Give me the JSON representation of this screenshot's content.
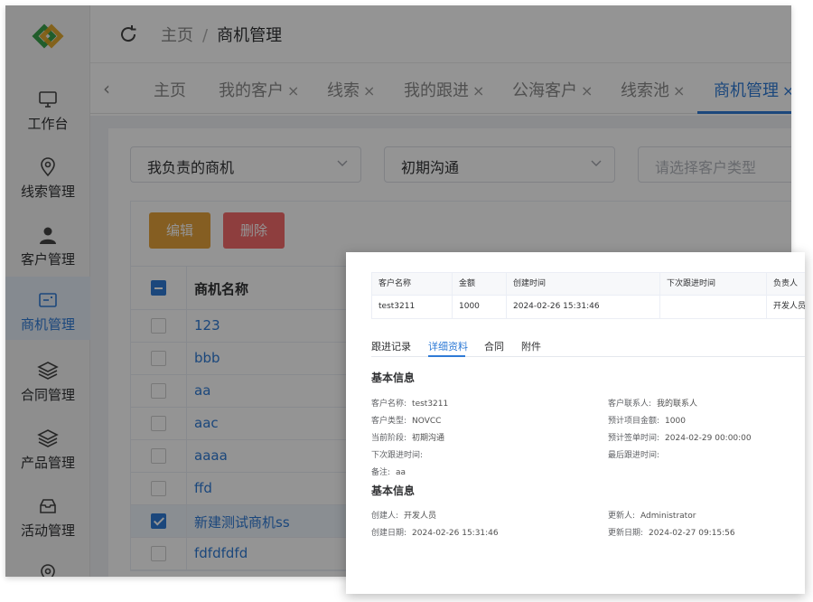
{
  "colors": {
    "primary": "#2f7bd6",
    "warning": "#e6a23c",
    "danger": "#f56c6c"
  },
  "sidebar": {
    "logo_icon": "logo-icon",
    "items": [
      {
        "label": "工作台",
        "icon": "monitor-icon"
      },
      {
        "label": "线索管理",
        "icon": "location-pin-icon"
      },
      {
        "label": "客户管理",
        "icon": "user-icon"
      },
      {
        "label": "商机管理",
        "icon": "opportunity-icon",
        "active": true
      },
      {
        "label": "合同管理",
        "icon": "layers-icon"
      },
      {
        "label": "产品管理",
        "icon": "layers-icon"
      },
      {
        "label": "活动管理",
        "icon": "inbox-icon"
      }
    ]
  },
  "header": {
    "breadcrumb_home": "主页",
    "breadcrumb_sep": "/",
    "breadcrumb_current": "商机管理"
  },
  "tabs": [
    {
      "label": "主页"
    },
    {
      "label": "我的客户",
      "close": "×"
    },
    {
      "label": "线索",
      "close": "×"
    },
    {
      "label": "我的跟进",
      "close": "×"
    },
    {
      "label": "公海客户",
      "close": "×"
    },
    {
      "label": "线索池",
      "close": "×"
    },
    {
      "label": "商机管理",
      "close": "×",
      "active": true
    }
  ],
  "filters": {
    "owner_value": "我负责的商机",
    "stage_value": "初期沟通",
    "customer_type_placeholder": "请选择客户类型"
  },
  "toolbar": {
    "edit_label": "编辑",
    "delete_label": "删除"
  },
  "list": {
    "header": "商机名称",
    "rows": [
      {
        "name": "123",
        "checked": false
      },
      {
        "name": "bbb",
        "checked": false
      },
      {
        "name": "aa",
        "checked": false
      },
      {
        "name": "aac",
        "checked": false
      },
      {
        "name": "aaaa",
        "checked": false
      },
      {
        "name": "ffd",
        "checked": false
      },
      {
        "name": "新建测试商机ss",
        "checked": true
      },
      {
        "name": "fdfdfdfd",
        "checked": false
      }
    ]
  },
  "detail": {
    "summary_headers": [
      "客户名称",
      "金额",
      "创建时间",
      "下次跟进时间",
      "负责人"
    ],
    "summary_values": [
      "test3211",
      "1000",
      "2024-02-26 15:31:46",
      "",
      "开发人员"
    ],
    "tabs": [
      "跟进记录",
      "详细资料",
      "合同",
      "附件"
    ],
    "active_tab": "详细资料",
    "basic_title": "基本信息",
    "basic_left": [
      {
        "k": "客户名称:",
        "v": "test3211"
      },
      {
        "k": "客户类型:",
        "v": "NOVCC"
      },
      {
        "k": "当前阶段:",
        "v": "初期沟通"
      },
      {
        "k": "下次跟进时间:",
        "v": ""
      },
      {
        "k": "备注:",
        "v": "aa"
      }
    ],
    "basic_right": [
      {
        "k": "客户联系人:",
        "v": "我的联系人"
      },
      {
        "k": "预计项目金额:",
        "v": "1000"
      },
      {
        "k": "预计签单时间:",
        "v": "2024-02-29 00:00:00"
      },
      {
        "k": "最后跟进时间:",
        "v": ""
      }
    ],
    "system_title": "基本信息",
    "system_left": [
      {
        "k": "创建人:",
        "v": "开发人员"
      },
      {
        "k": "创建日期:",
        "v": "2024-02-26 15:31:46"
      }
    ],
    "system_right": [
      {
        "k": "更新人:",
        "v": "Administrator"
      },
      {
        "k": "更新日期:",
        "v": "2024-02-27 09:15:56"
      }
    ]
  }
}
